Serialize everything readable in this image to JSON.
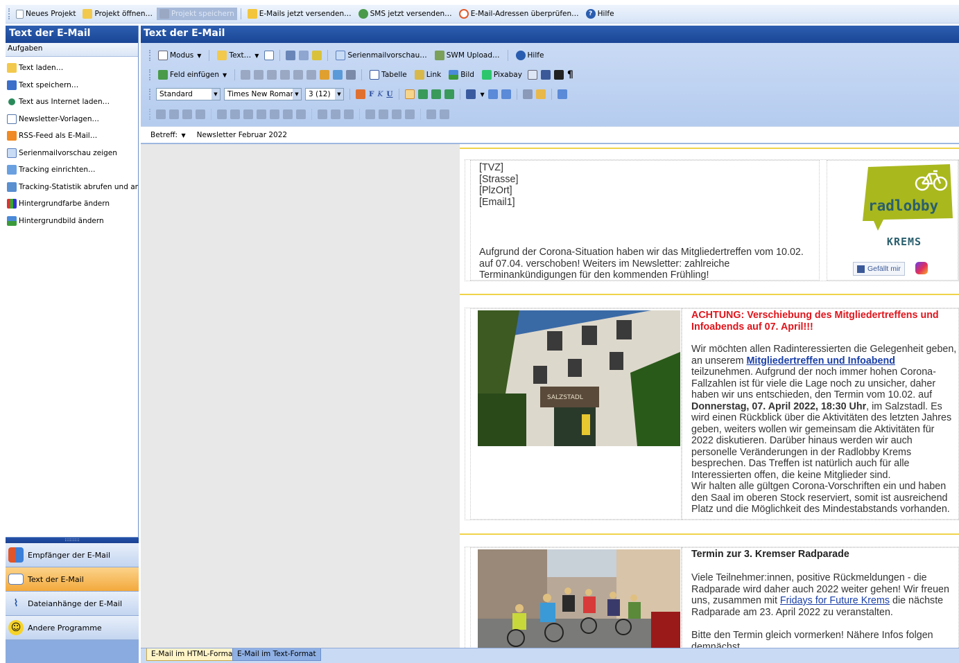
{
  "toolbar": {
    "new_project": "Neues Projekt",
    "open_project": "Projekt öffnen…",
    "save_project": "Projekt speichern",
    "send_emails": "E-Mails jetzt versenden…",
    "send_sms": "SMS jetzt versenden…",
    "check_addresses": "E-Mail-Adressen überprüfen…",
    "help": "Hilfe"
  },
  "left_panel": {
    "title": "Text der E-Mail",
    "subtitle": "Aufgaben",
    "tasks": [
      "Text laden…",
      "Text speichern…",
      "Text aus Internet laden…",
      "Newsletter-Vorlagen…",
      "RSS-Feed als E-Mail…",
      "Serienmailvorschau zeigen",
      "Tracking einrichten…",
      "Tracking-Statistik abrufen und an…",
      "Hintergrundfarbe ändern",
      "Hintergrundbild ändern"
    ],
    "nav": [
      "Empfänger der E-Mail",
      "Text der E-Mail",
      "Dateianhänge der E-Mail",
      "Andere Programme"
    ]
  },
  "main": {
    "title": "Text der E-Mail",
    "row1": {
      "mode": "Modus",
      "text": "Text…",
      "preview": "Serienmailvorschau…",
      "swm_upload": "SWM Upload…",
      "help": "Hilfe"
    },
    "row2": {
      "insert_field": "Feld einfügen",
      "table": "Tabelle",
      "link": "Link",
      "image": "Bild",
      "pixabay": "Pixabay"
    },
    "row3": {
      "style": "Standard",
      "font": "Times New Roman",
      "size": "3 (12)",
      "bold": "F",
      "italic": "K",
      "underline": "U"
    },
    "subject_label": "Betreff:",
    "subject_value": "Newsletter Februar 2022"
  },
  "doc": {
    "fields": [
      "[TVZ]",
      "[Strasse]",
      "[PlzOrt]",
      "[Email1]"
    ],
    "intro": "Aufgrund der Corona-Situation haben wir das Mitgliedertreffen vom 10.02. auf 07.04. verschoben! Weiters im Newsletter: zahlreiche Terminankündigungen für den kommenden Frühling!",
    "logo_text": "radlobby",
    "logo_sub": "KREMS",
    "like": "Gefällt mir",
    "article1": {
      "headline": "ACHTUNG: Verschiebung des Mitgliedertreffens und Infoabends auf 07. April!!!",
      "p1_start": "Wir möchten allen Radinteressierten die Gelegenheit geben, an unserem ",
      "p1_link": "Mitgliedertreffen und Infoabend",
      "p1_mid": " teilzunehmen. Aufgrund der noch immer hohen Corona-Fallzahlen ist für viele die Lage noch zu unsicher, daher haben wir uns entschieden, den Termin vom 10.02. auf ",
      "p1_bold": "Donnerstag, 07. April 2022, 18:30 Uhr",
      "p1_end": ", im Salzstadl. Es wird einen Rückblick über die Aktivitäten des letzten Jahres geben, weiters wollen wir gemeinsam die Aktivitäten für 2022 diskutieren. Darüber hinaus werden wir auch personelle Veränderungen in der Radlobby Krems besprechen. Das Treffen ist natürlich auch für alle Interessierten offen, die keine Mitglieder sind.",
      "p2": "Wir halten alle gültgen Corona-Vorschriften ein und haben den Saal im oberen Stock reserviert, somit ist ausreichend Platz und die Möglichkeit des Mindestabstands vorhanden.",
      "sign": "SALZSTADL"
    },
    "article2": {
      "headline": "Termin zur 3. Kremser Radparade",
      "p1_start": "Viele Teilnehmer:innen, positive Rückmeldungen - die Radparade wird daher auch 2022 weiter gehen! Wir freuen uns, zusammen mit ",
      "p1_link": "Fridays for Future Krems",
      "p1_end": " die nächste Radparade am 23. April 2022 zu veranstalten.",
      "p2": "Bitte den Termin gleich vormerken! Nähere Infos folgen demnächst."
    }
  },
  "tabs": {
    "html": "E-Mail im HTML-Format",
    "text": "E-Mail im Text-Format"
  }
}
